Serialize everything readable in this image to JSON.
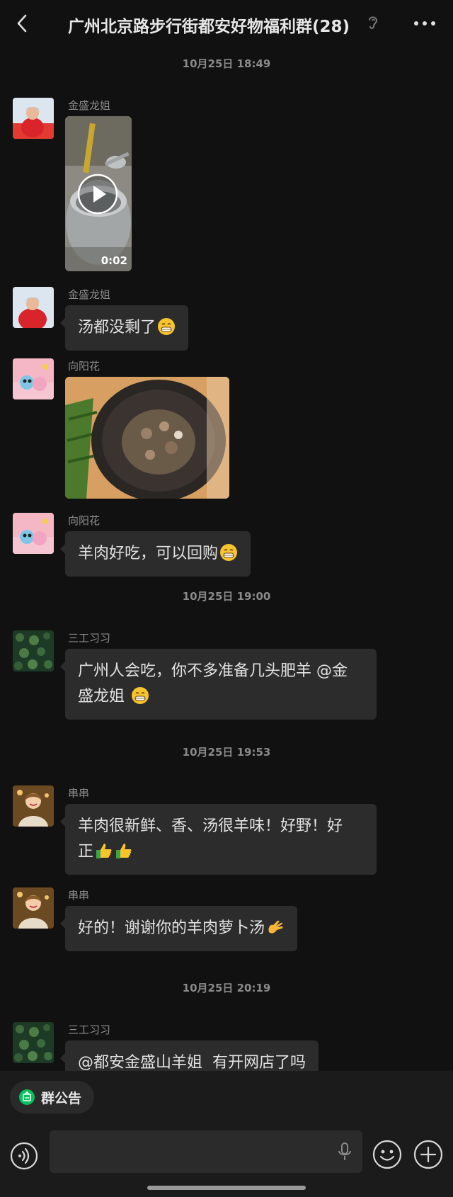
{
  "header": {
    "title": "广州北京路步行街都安好物福利群(28)",
    "back_icon": "chevron-left-icon",
    "mute_icon": "ear-muted-icon",
    "more_icon": "more-dots-icon"
  },
  "timestamps": {
    "t1": "10月25日 18:49",
    "t2": "10月25日 19:00",
    "t3": "10月25日 19:53",
    "t4": "10月25日 20:19"
  },
  "messages": [
    {
      "sender": "金盛龙姐",
      "type": "video",
      "duration": "0:02"
    },
    {
      "sender": "金盛龙姐",
      "type": "text",
      "text": "汤都没剩了",
      "emoji": "grin-emoji"
    },
    {
      "sender": "向阳花",
      "type": "image"
    },
    {
      "sender": "向阳花",
      "type": "text",
      "text": "羊肉好吃，可以回购",
      "emoji": "grin-emoji"
    },
    {
      "sender": "三工习习",
      "type": "text",
      "line1": "广州人会吃，你不多准备几头肥羊 @金",
      "line2": "盛龙姐 ",
      "emoji": "grin-emoji"
    },
    {
      "sender": "串串",
      "type": "text",
      "line1": "羊肉很新鲜、香、汤很羊味！好野！好",
      "line2": "正",
      "emoji": "thumbs-up-emoji"
    },
    {
      "sender": "串串",
      "type": "text",
      "text": "好的！谢谢你的羊肉萝卜汤",
      "emoji": "ok-hand-emoji"
    },
    {
      "sender": "三工习习",
      "type": "text",
      "text": "@都安金盛山羊姐  有开网店了吗"
    }
  ],
  "bottom": {
    "notice_label": "群公告",
    "accent": "#07c160"
  }
}
